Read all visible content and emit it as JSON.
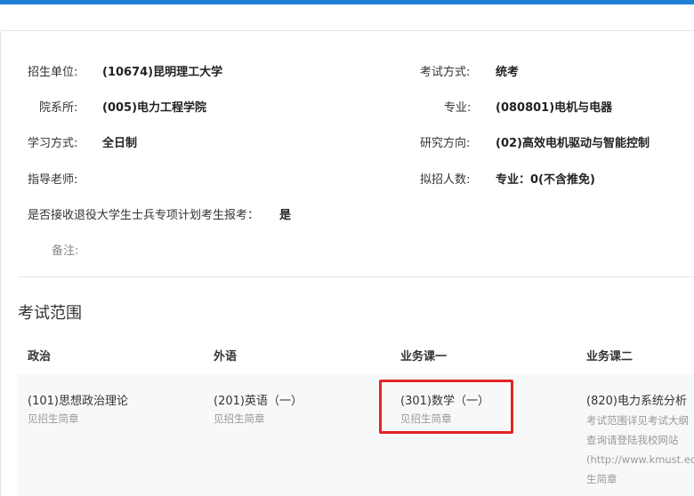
{
  "info": {
    "unit_label": "招生单位:",
    "unit_value": "(10674)昆明理工大学",
    "exam_method_label": "考试方式:",
    "exam_method_value": "统考",
    "department_label": "院系所:",
    "department_value": "(005)电力工程学院",
    "major_label": "专业:",
    "major_value": "(080801)电机与电器",
    "study_mode_label": "学习方式:",
    "study_mode_value": "全日制",
    "research_label": "研究方向:",
    "research_value": "(02)高效电机驱动与智能控制",
    "advisor_label": "指导老师:",
    "advisor_value": "",
    "quota_label": "拟招人数:",
    "quota_value": "专业：0(不含推免)",
    "veteran_label": "是否接收退役大学生士兵专项计划考生报考：",
    "veteran_value": "是",
    "remark_label": "备注:",
    "remark_value": ""
  },
  "exam_scope": {
    "title": "考试范围",
    "headers": [
      "政治",
      "外语",
      "业务课一",
      "业务课二"
    ],
    "subjects": [
      {
        "name": "(101)思想政治理论",
        "note": "见招生简章"
      },
      {
        "name": "(201)英语（一）",
        "note": "见招生简章"
      },
      {
        "name": "(301)数学（一）",
        "note": "见招生简章"
      },
      {
        "name": "(820)电力系统分析",
        "note_lines": [
          "考试范围详见考试大纲",
          "查询请登陆我校网站",
          "(http://www.kmust.edu.",
          "生简章"
        ]
      }
    ]
  },
  "colors": {
    "top_strip": "#1e7fd4",
    "highlight": "#e52424",
    "row_background": "#f7f8fa",
    "note_text": "#999999"
  }
}
